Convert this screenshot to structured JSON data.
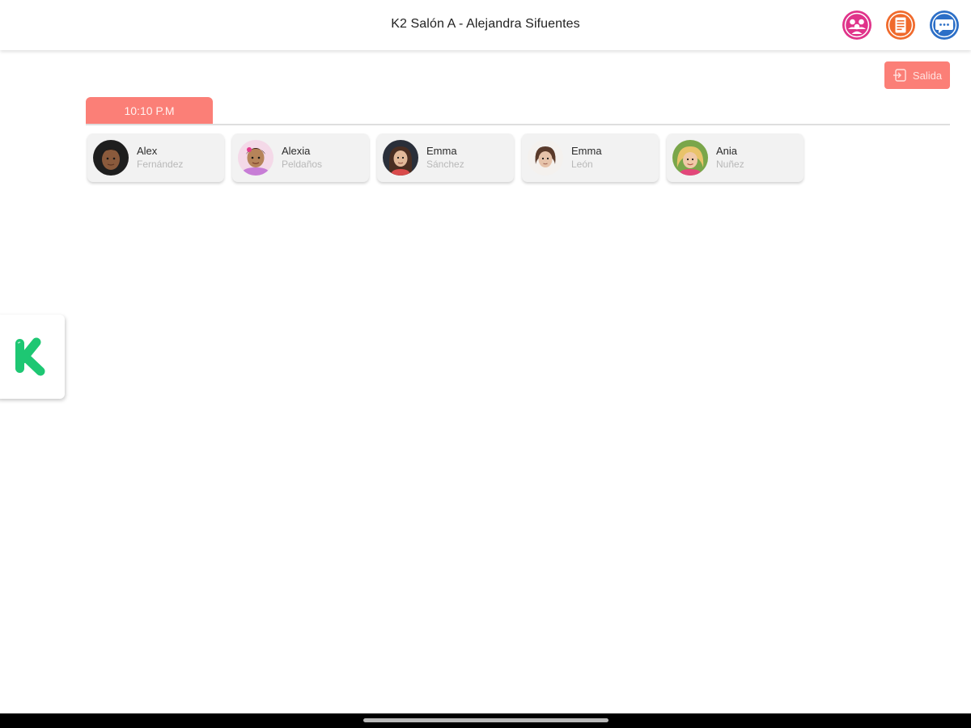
{
  "header": {
    "title": "K2 Salón A - Alejandra Sifuentes",
    "icons": [
      {
        "name": "group-icon",
        "color": "#e0338a"
      },
      {
        "name": "document-icon",
        "color": "#f06a2c"
      },
      {
        "name": "chat-icon",
        "color": "#2c6fc7"
      }
    ]
  },
  "exit_button": {
    "label": "Salida",
    "icon": "exit-icon",
    "color": "#fb7f77"
  },
  "time_tab": {
    "label": "10:10 P.M"
  },
  "students": [
    {
      "first_name": "Alex",
      "last_name": "Fernández"
    },
    {
      "first_name": "Alexia",
      "last_name": "Peldaños"
    },
    {
      "first_name": "Emma",
      "last_name": "Sánchez"
    },
    {
      "first_name": "Emma",
      "last_name": "León"
    },
    {
      "first_name": "Ania",
      "last_name": "Nuñez"
    }
  ],
  "side_tab": {
    "logo": "k-logo",
    "color": "#1ec773"
  },
  "colors": {
    "accent": "#fb7f77",
    "card_bg": "#f2f2f2"
  }
}
